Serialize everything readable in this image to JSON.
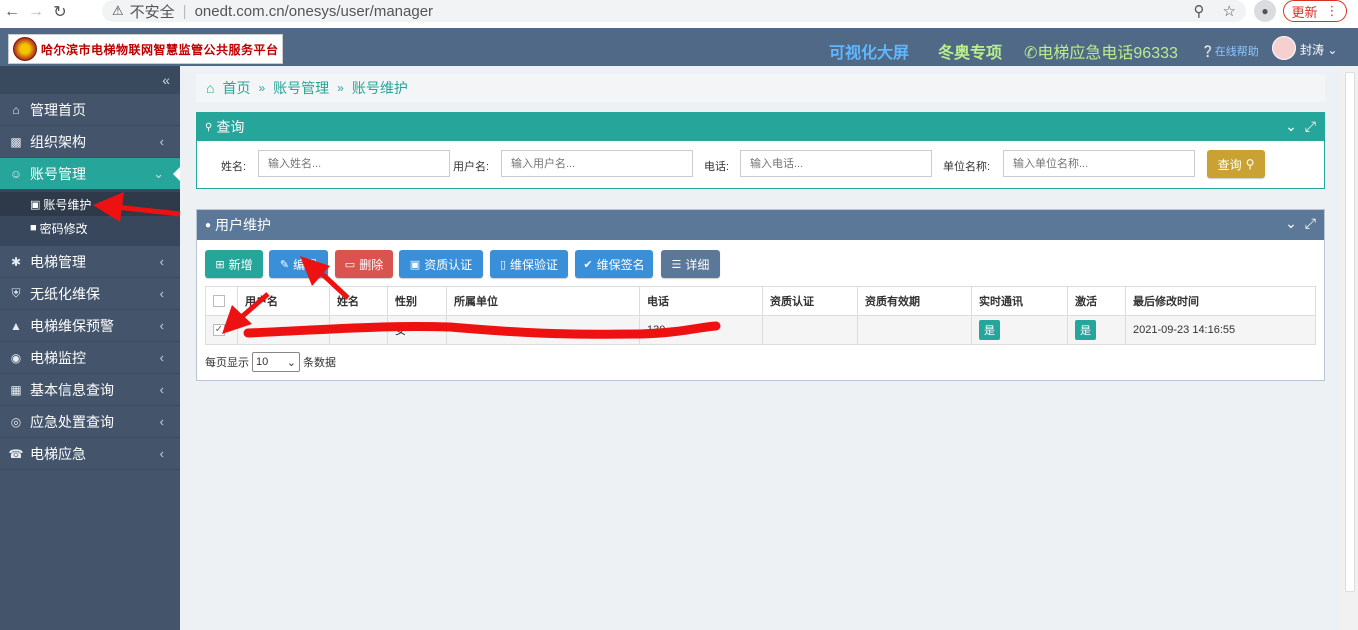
{
  "browser": {
    "insecure_label": "不安全",
    "url": "onedt.com.cn/onesys/user/manager",
    "update_label": "更新"
  },
  "header": {
    "platform_title": "哈尔滨市电梯物联网智慧监管公共服务平台",
    "link_big_screen": "可视化大屏",
    "link_winter": "冬奥专项",
    "hotline": "电梯应急电话96333",
    "help": "在线帮助",
    "user_name": "封涛"
  },
  "sidebar": {
    "items": [
      {
        "label": "管理首页",
        "icon": "home-icon"
      },
      {
        "label": "组织架构",
        "icon": "sitemap-icon"
      },
      {
        "label": "账号管理",
        "icon": "user-circle-icon"
      },
      {
        "label": "电梯管理",
        "icon": "asterisk-icon"
      },
      {
        "label": "无纸化维保",
        "icon": "shield-icon"
      },
      {
        "label": "电梯维保预警",
        "icon": "briefcase-icon"
      },
      {
        "label": "电梯监控",
        "icon": "record-icon"
      },
      {
        "label": "基本信息查询",
        "icon": "table-icon"
      },
      {
        "label": "应急处置查询",
        "icon": "lifebuoy-icon"
      },
      {
        "label": "电梯应急",
        "icon": "phone-volume-icon"
      }
    ],
    "sub_items": [
      {
        "label": "账号维护",
        "icon": "id-card-icon"
      },
      {
        "label": "密码修改",
        "icon": "lock-icon"
      }
    ]
  },
  "breadcrumb": {
    "home": "首页",
    "level1": "账号管理",
    "level2": "账号维护"
  },
  "query_panel": {
    "title": "查询",
    "fields": [
      {
        "label": "姓名:",
        "placeholder": "输入姓名..."
      },
      {
        "label": "用户名:",
        "placeholder": "输入用户名..."
      },
      {
        "label": "电话:",
        "placeholder": "输入电话..."
      },
      {
        "label": "单位名称:",
        "placeholder": "输入单位名称..."
      }
    ],
    "query_button": "查询"
  },
  "user_panel": {
    "title": "用户维护",
    "buttons": {
      "add": "新增",
      "edit": "编辑",
      "delete": "删除",
      "qualification": "资质认证",
      "maint_verify": "维保验证",
      "maint_sign": "维保签名",
      "detail": "详细"
    },
    "columns": [
      "用户名",
      "姓名",
      "性别",
      "所属单位",
      "电话",
      "资质认证",
      "资质有效期",
      "实时通讯",
      "激活",
      "最后修改时间"
    ],
    "rows": [
      {
        "username": "",
        "name": "",
        "gender": "女",
        "unit": "",
        "phone": "130",
        "qualification": "",
        "qual_expiry": "",
        "realtime": "是",
        "active": "是",
        "modified": "2021-09-23 14:16:55"
      }
    ],
    "pager": {
      "prefix": "每页显示",
      "page_size": "10",
      "suffix": "条数据"
    }
  },
  "colors": {
    "header_bg": "#4f6987",
    "sidebar_bg": "#43546b",
    "accent": "#26a69a",
    "query_button": "#c9a233",
    "delete_button": "#d9534f",
    "info_button": "#3a8fd9",
    "annotation_red": "#ee1111"
  }
}
